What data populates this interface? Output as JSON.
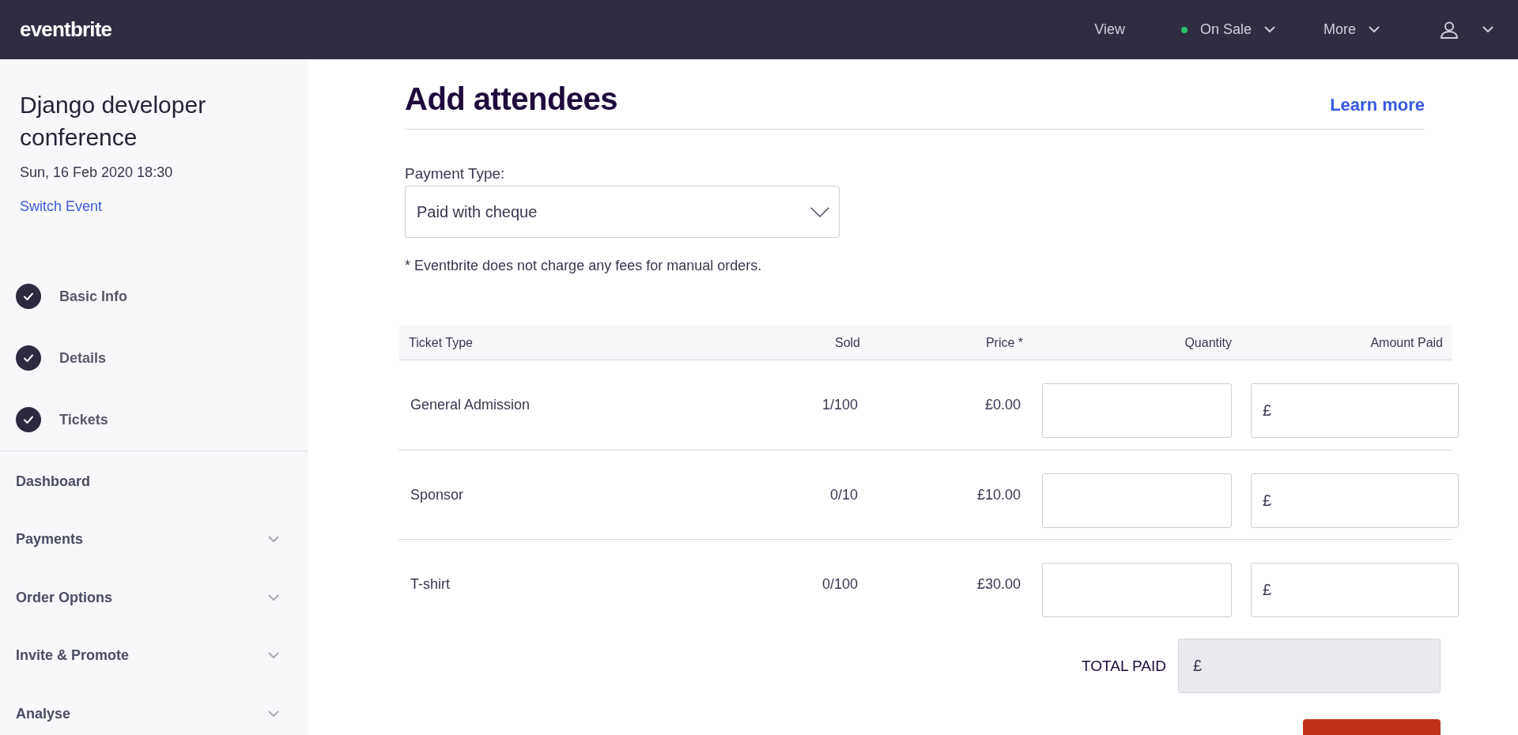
{
  "top_bar": {
    "logo": "eventbrite",
    "nav": [
      {
        "kind": "link",
        "label": "View"
      },
      {
        "kind": "status-menu",
        "label": "On Sale"
      },
      {
        "kind": "menu",
        "label": "More"
      },
      {
        "kind": "account-menu"
      }
    ]
  },
  "sidebar": {
    "event": {
      "title": "Django developer conference",
      "date": "Sun, 16 Feb 2020 18:30",
      "switch_link": "Switch Event"
    },
    "steps": [
      {
        "label": "Basic Info",
        "checked": true
      },
      {
        "label": "Details",
        "checked": true
      },
      {
        "label": "Tickets",
        "checked": true
      }
    ],
    "nav": [
      {
        "kind": "link",
        "label": "Dashboard"
      },
      {
        "kind": "group",
        "label": "Payments"
      },
      {
        "kind": "group",
        "label": "Order Options"
      },
      {
        "kind": "group",
        "label": "Invite & Promote"
      },
      {
        "kind": "group",
        "label": "Analyse"
      }
    ]
  },
  "main": {
    "title": "Add attendees",
    "learn_more": "Learn more",
    "payment_type": {
      "label": "Payment Type:",
      "value": "Paid with cheque"
    },
    "note": "* Eventbrite does not charge any fees for manual orders.",
    "table": {
      "columns": [
        "Ticket Type",
        "Sold",
        "Price *",
        "Quantity",
        "Amount Paid"
      ],
      "rows": [
        {
          "ticket_type": "General Admission",
          "sold": "1/100",
          "price": "£0.00",
          "amount_prefix": "£"
        },
        {
          "ticket_type": "Sponsor",
          "sold": "0/10",
          "price": "£10.00",
          "amount_prefix": "£"
        },
        {
          "ticket_type": "T-shirt",
          "sold": "0/100",
          "price": "£30.00",
          "amount_prefix": "£"
        }
      ]
    },
    "total": {
      "label": "TOTAL PAID",
      "prefix": "£",
      "disabled": true
    }
  }
}
